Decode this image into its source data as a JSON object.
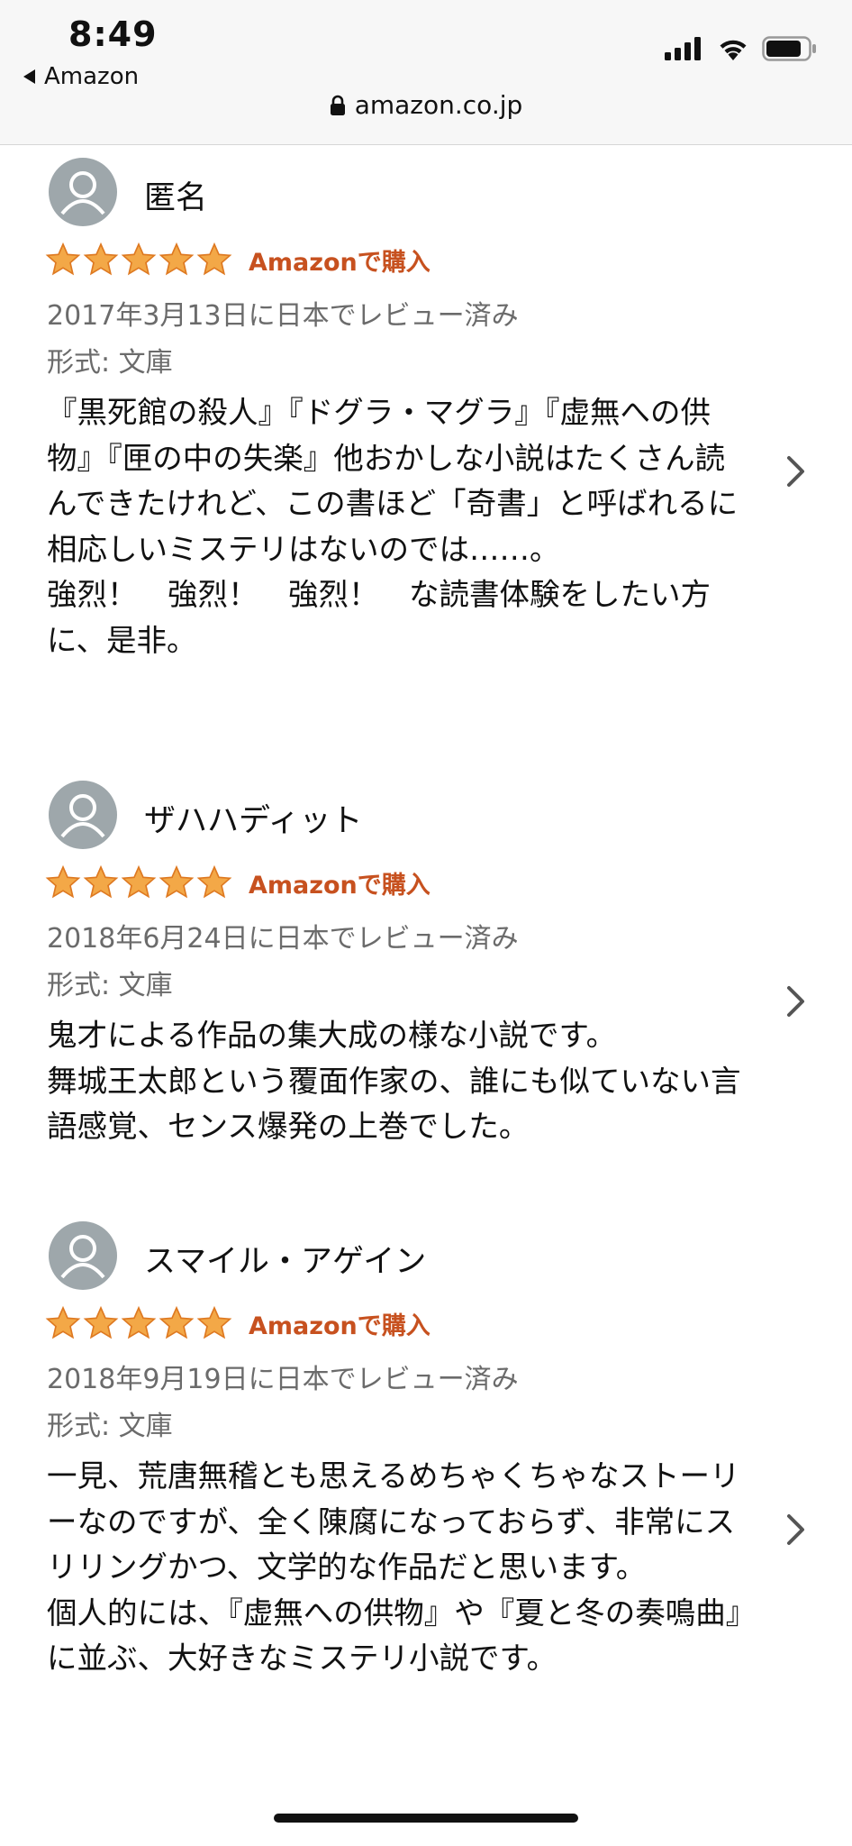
{
  "status_bar": {
    "time": "8:49",
    "back_label": "Amazon"
  },
  "browser": {
    "url": "amazon.co.jp"
  },
  "colors": {
    "star": "#f3a847",
    "star_outline": "#de7921",
    "purchase_badge": "#c7511f",
    "secondary_text": "#6b6b6b"
  },
  "reviews": [
    {
      "reviewer": "匿名",
      "rating": 5,
      "badge": "Amazonで購入",
      "date": "2017年3月13日に日本でレビュー済み",
      "format": "形式: 文庫",
      "body": "『黒死館の殺人』『ドグラ・マグラ』『虚無への供物』『匣の中の失楽』他おかしな小説はたくさん読んできたけれど、この書ほど「奇書」と呼ばれるに相応しいミステリはないのでは……。\n強烈！　強烈！　強烈！　な読書体験をしたい方に、是非。"
    },
    {
      "reviewer": "ザハハディット",
      "rating": 5,
      "badge": "Amazonで購入",
      "date": "2018年6月24日に日本でレビュー済み",
      "format": "形式: 文庫",
      "body": "鬼才による作品の集大成の様な小説です。\n舞城王太郎という覆面作家の、誰にも似ていない言語感覚、センス爆発の上巻でした。"
    },
    {
      "reviewer": "スマイル・アゲイン",
      "rating": 5,
      "badge": "Amazonで購入",
      "date": "2018年9月19日に日本でレビュー済み",
      "format": "形式: 文庫",
      "body": "一見、荒唐無稽とも思えるめちゃくちゃなストーリーなのですが、全く陳腐になっておらず、非常にスリリングかつ、文学的な作品だと思います。\n個人的には、『虚無への供物』や『夏と冬の奏鳴曲』に並ぶ、大好きなミステリ小説です。"
    }
  ]
}
